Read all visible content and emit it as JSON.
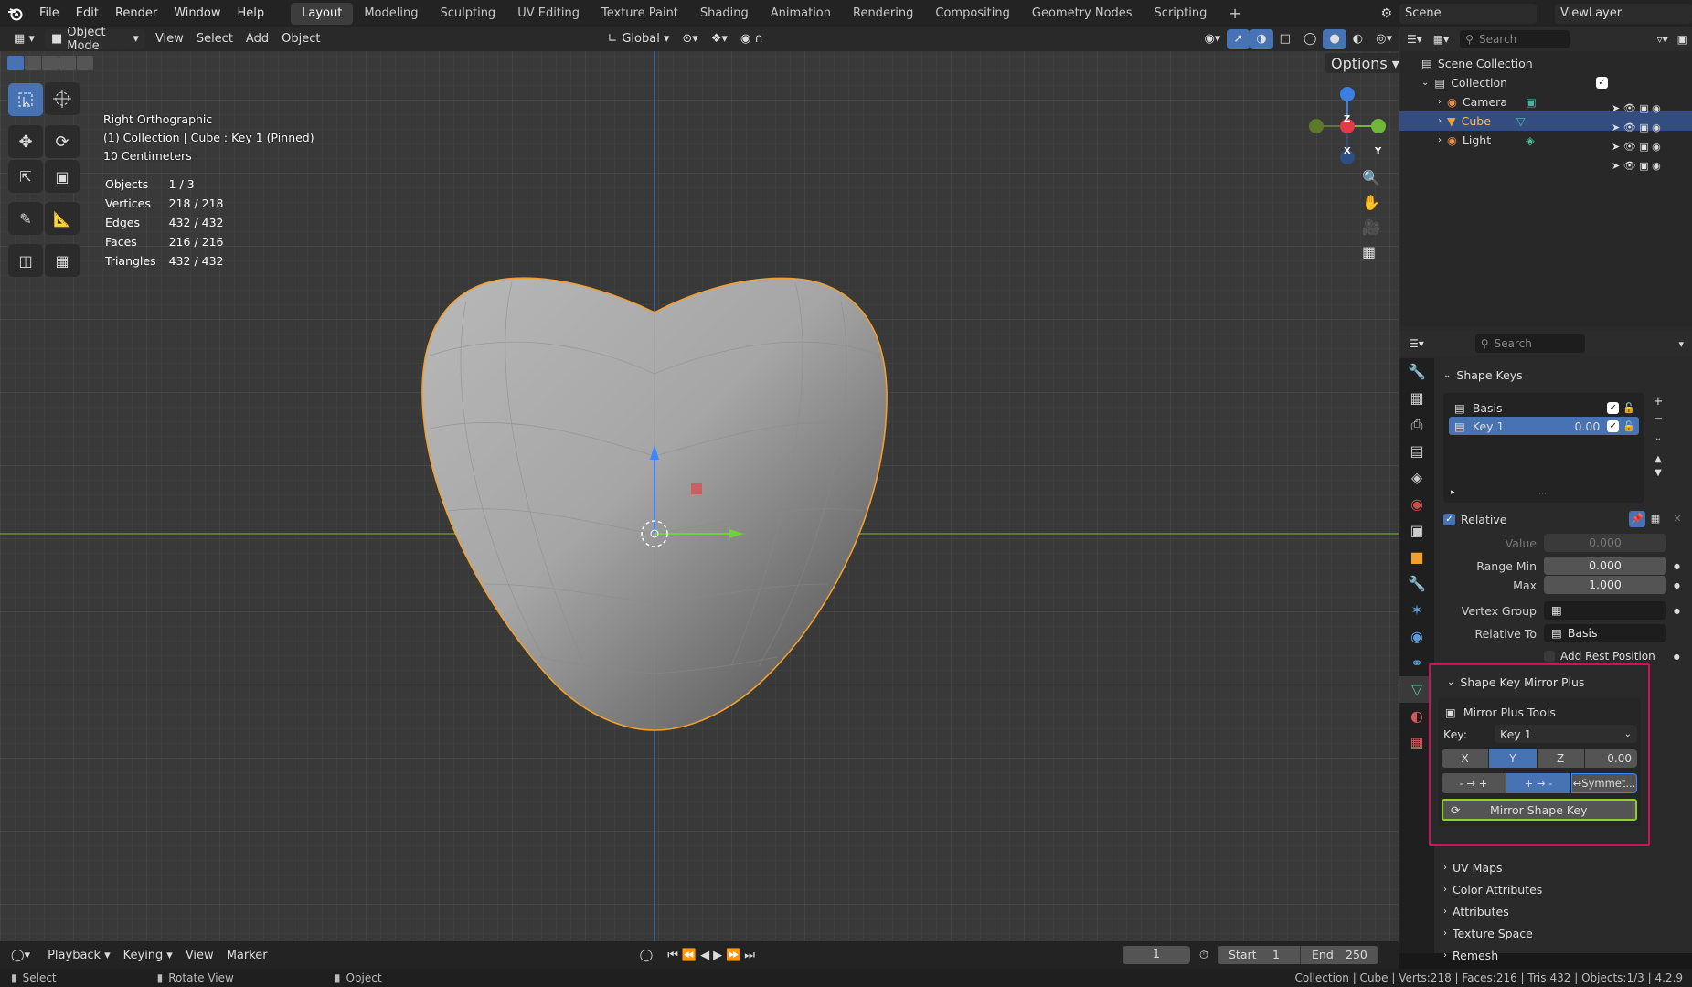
{
  "menu": {
    "file": "File",
    "edit": "Edit",
    "render": "Render",
    "window": "Window",
    "help": "Help"
  },
  "workspaces": [
    "Layout",
    "Modeling",
    "Sculpting",
    "UV Editing",
    "Texture Paint",
    "Shading",
    "Animation",
    "Rendering",
    "Compositing",
    "Geometry Nodes",
    "Scripting"
  ],
  "scene": {
    "name": "Scene",
    "viewlayer": "ViewLayer"
  },
  "vp_header": {
    "mode": "Object Mode",
    "view": "View",
    "select": "Select",
    "add": "Add",
    "object": "Object",
    "orientation": "Global",
    "options": "Options"
  },
  "overlay": {
    "line1": "Right Orthographic",
    "line2": "(1) Collection | Cube : Key 1 (Pinned)",
    "line3": "10 Centimeters"
  },
  "stats": [
    {
      "k": "Objects",
      "v": "1 / 3"
    },
    {
      "k": "Vertices",
      "v": "218 / 218"
    },
    {
      "k": "Edges",
      "v": "432 / 432"
    },
    {
      "k": "Faces",
      "v": "216 / 216"
    },
    {
      "k": "Triangles",
      "v": "432 / 432"
    }
  ],
  "gizmo": {
    "z": "Z",
    "x": "X",
    "y": "Y"
  },
  "outliner": {
    "search": "Search",
    "scene_collection": "Scene Collection",
    "collection": "Collection",
    "items": [
      "Camera",
      "Cube",
      "Light"
    ]
  },
  "props": {
    "search": "Search",
    "shape_keys": "Shape Keys",
    "keys": [
      {
        "name": "Basis",
        "value": ""
      },
      {
        "name": "Key 1",
        "value": "0.00"
      }
    ],
    "relative": "Relative",
    "value_label": "Value",
    "value": "0.000",
    "range_min_label": "Range Min",
    "range_min": "0.000",
    "max_label": "Max",
    "max": "1.000",
    "vgroup_label": "Vertex Group",
    "relative_to_label": "Relative To",
    "relative_to": "Basis",
    "add_rest": "Add Rest Position",
    "mirror_plus": "Shape Key Mirror Plus",
    "tools_title": "Mirror Plus Tools",
    "key_label": "Key:",
    "key_value": "Key 1",
    "axes": [
      "X",
      "Y",
      "Z"
    ],
    "axis_val": "0.00",
    "dir1": "- → +",
    "dir2": "+ → -",
    "symmetric": "Symmet...",
    "mirror_btn": "Mirror Shape Key",
    "sections": [
      "UV Maps",
      "Color Attributes",
      "Attributes",
      "Texture Space",
      "Remesh"
    ]
  },
  "timeline": {
    "playback": "Playback",
    "keying": "Keying",
    "view": "View",
    "marker": "Marker",
    "frame": "1",
    "start_label": "Start",
    "start": "1",
    "end_label": "End",
    "end": "250"
  },
  "status": {
    "select": "Select",
    "rotate": "Rotate View",
    "object": "Object",
    "info": "Collection | Cube | Verts:218 | Faces:216 | Tris:432 | Objects:1/3 | 4.2.9"
  },
  "colors": {
    "accent": "#4772b3",
    "highlight": "#d0105a",
    "green_outline": "#8fd12b",
    "selection_orange": "#f0a030"
  }
}
